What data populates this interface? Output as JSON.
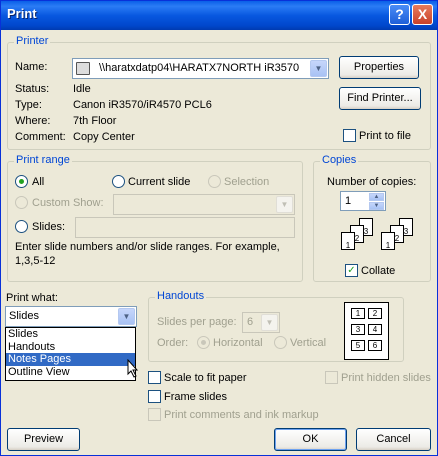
{
  "titlebar": {
    "title": "Print",
    "help_glyph": "?",
    "close_glyph": "X"
  },
  "printer": {
    "legend": "Printer",
    "name_label": "Name:",
    "name_value": "\\\\haratxdatp04\\HARATX7NORTH iR3570",
    "status_label": "Status:",
    "status_value": "Idle",
    "type_label": "Type:",
    "type_value": "Canon iR3570/iR4570 PCL6",
    "where_label": "Where:",
    "where_value": "7th Floor",
    "comment_label": "Comment:",
    "comment_value": "Copy Center",
    "properties_button": "Properties",
    "find_printer_button": "Find Printer...",
    "print_to_file_label": "Print to file"
  },
  "print_range": {
    "legend": "Print range",
    "all_label": "All",
    "current_slide_label": "Current slide",
    "selection_label": "Selection",
    "custom_show_label": "Custom Show:",
    "slides_label": "Slides:",
    "help_text_1": "Enter slide numbers and/or slide ranges. For example,",
    "help_text_2": "1,3,5-12"
  },
  "copies": {
    "legend": "Copies",
    "number_label": "Number of copies:",
    "number_value": "1",
    "collate_label": "Collate",
    "page_numbers": [
      "1",
      "2",
      "3"
    ]
  },
  "print_what": {
    "label": "Print what:",
    "selected": "Slides",
    "options": [
      "Slides",
      "Handouts",
      "Notes Pages",
      "Outline View"
    ],
    "highlighted": "Notes Pages"
  },
  "handouts": {
    "legend": "Handouts",
    "slides_per_page_label": "Slides per page:",
    "slides_per_page_value": "6",
    "order_label": "Order:",
    "horizontal_label": "Horizontal",
    "vertical_label": "Vertical",
    "preview_numbers": [
      "1",
      "2",
      "3",
      "4",
      "5",
      "6"
    ]
  },
  "options": {
    "scale_to_fit": "Scale to fit paper",
    "frame_slides": "Frame slides",
    "print_comments": "Print comments and ink markup",
    "print_hidden": "Print hidden slides"
  },
  "buttons": {
    "preview": "Preview",
    "ok": "OK",
    "cancel": "Cancel"
  }
}
